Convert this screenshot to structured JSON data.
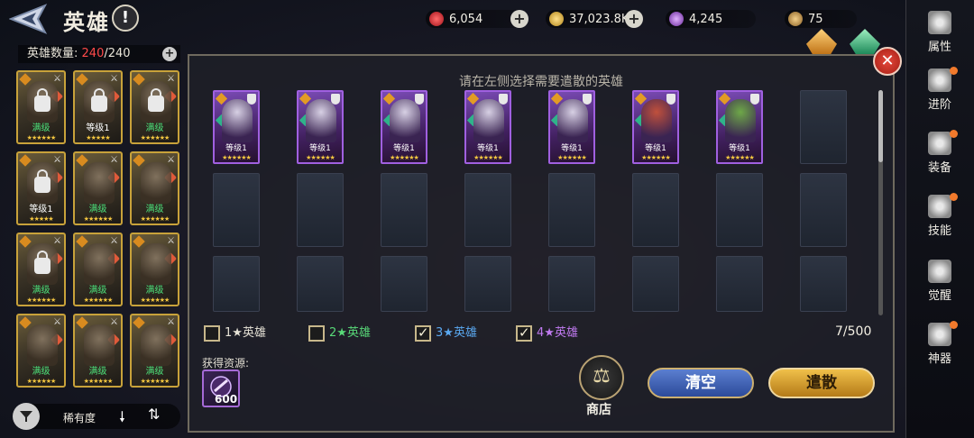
{
  "header": {
    "title": "英雄",
    "help_label": "!"
  },
  "resources": {
    "ruby": "6,054",
    "gold": "37,023.8K",
    "essence": "4,245",
    "scroll": "75",
    "plus": "+"
  },
  "hero_list": {
    "count_label": "英雄数量:",
    "count_current": "240",
    "count_total": "/240",
    "heroes": [
      {
        "level": "满级",
        "max": true,
        "locked": true,
        "stars": "★★★★★★"
      },
      {
        "level": "等级1",
        "max": false,
        "locked": true,
        "stars": "★★★★★"
      },
      {
        "level": "满级",
        "max": true,
        "locked": true,
        "stars": "★★★★★★"
      },
      {
        "level": "等级1",
        "max": false,
        "locked": true,
        "stars": "★★★★★"
      },
      {
        "level": "满级",
        "max": true,
        "locked": false,
        "stars": "★★★★★★"
      },
      {
        "level": "满级",
        "max": true,
        "locked": false,
        "stars": "★★★★★★"
      },
      {
        "level": "满级",
        "max": true,
        "locked": true,
        "stars": "★★★★★★"
      },
      {
        "level": "满级",
        "max": true,
        "locked": false,
        "stars": "★★★★★★"
      },
      {
        "level": "满级",
        "max": true,
        "locked": false,
        "stars": "★★★★★★"
      },
      {
        "level": "满级",
        "max": true,
        "locked": false,
        "stars": "★★★★★★"
      },
      {
        "level": "满级",
        "max": true,
        "locked": false,
        "stars": "★★★★★★"
      },
      {
        "level": "满级",
        "max": true,
        "locked": false,
        "stars": "★★★★★★"
      }
    ],
    "sort_label": "稀有度",
    "sort_arrow": "🠗",
    "order_label": "⇅"
  },
  "dialog": {
    "title": "请在左侧选择需要遣散的英雄",
    "close_label": "✕",
    "selected": [
      {
        "level": "等级1",
        "stars": "★★★★★★",
        "portrait": "#d7d0e4"
      },
      {
        "level": "等级1",
        "stars": "★★★★★★",
        "portrait": "#d7d0e4"
      },
      {
        "level": "等级1",
        "stars": "★★★★★★",
        "portrait": "#d7d0e4"
      },
      {
        "level": "等级1",
        "stars": "★★★★★★",
        "portrait": "#d7d0e4"
      },
      {
        "level": "等级1",
        "stars": "★★★★★★",
        "portrait": "#d7d0e4"
      },
      {
        "level": "等级1",
        "stars": "★★★★★★",
        "portrait": "#c0503c"
      },
      {
        "level": "等级1",
        "stars": "★★★★★★",
        "portrait": "#6ea848"
      }
    ],
    "filters": [
      {
        "num": "1",
        "label": "英雄",
        "checked": false,
        "color": "#e6e2d6"
      },
      {
        "num": "2",
        "label": "英雄",
        "checked": false,
        "color": "#58d878"
      },
      {
        "num": "3",
        "label": "英雄",
        "checked": true,
        "color": "#5aa8f0"
      },
      {
        "num": "4",
        "label": "英雄",
        "checked": true,
        "color": "#c07af0"
      }
    ],
    "star": "★",
    "count_info": "7/500",
    "resource_title": "获得资源:",
    "resource_amount": "600",
    "shop_label": "商店",
    "clear_label": "清空",
    "dismiss_label": "遣散"
  },
  "side_menu": [
    {
      "label": "属性",
      "dot": false
    },
    {
      "label": "进阶",
      "dot": true
    },
    {
      "label": "装备",
      "dot": true
    },
    {
      "label": "技能",
      "dot": true
    },
    {
      "label": "觉醒",
      "dot": false
    },
    {
      "label": "神器",
      "dot": true
    }
  ],
  "colors": {
    "accent_gold": "#c8a23a",
    "epic_purple": "#a060e0",
    "max_green": "#4de07a",
    "count_red": "#ff4a4a"
  }
}
